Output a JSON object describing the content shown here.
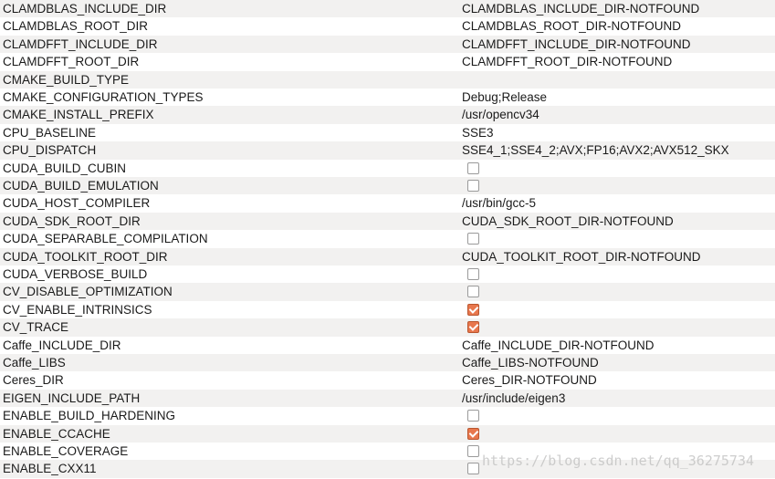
{
  "rows": [
    {
      "name": "CLAMDBLAS_INCLUDE_DIR",
      "type": "text",
      "value": "CLAMDBLAS_INCLUDE_DIR-NOTFOUND"
    },
    {
      "name": "CLAMDBLAS_ROOT_DIR",
      "type": "text",
      "value": "CLAMDBLAS_ROOT_DIR-NOTFOUND"
    },
    {
      "name": "CLAMDFFT_INCLUDE_DIR",
      "type": "text",
      "value": "CLAMDFFT_INCLUDE_DIR-NOTFOUND"
    },
    {
      "name": "CLAMDFFT_ROOT_DIR",
      "type": "text",
      "value": "CLAMDFFT_ROOT_DIR-NOTFOUND"
    },
    {
      "name": "CMAKE_BUILD_TYPE",
      "type": "text",
      "value": ""
    },
    {
      "name": "CMAKE_CONFIGURATION_TYPES",
      "type": "text",
      "value": "Debug;Release"
    },
    {
      "name": "CMAKE_INSTALL_PREFIX",
      "type": "text",
      "value": "/usr/opencv34"
    },
    {
      "name": "CPU_BASELINE",
      "type": "text",
      "value": "SSE3"
    },
    {
      "name": "CPU_DISPATCH",
      "type": "text",
      "value": "SSE4_1;SSE4_2;AVX;FP16;AVX2;AVX512_SKX"
    },
    {
      "name": "CUDA_BUILD_CUBIN",
      "type": "bool",
      "checked": false
    },
    {
      "name": "CUDA_BUILD_EMULATION",
      "type": "bool",
      "checked": false
    },
    {
      "name": "CUDA_HOST_COMPILER",
      "type": "text",
      "value": "/usr/bin/gcc-5"
    },
    {
      "name": "CUDA_SDK_ROOT_DIR",
      "type": "text",
      "value": "CUDA_SDK_ROOT_DIR-NOTFOUND"
    },
    {
      "name": "CUDA_SEPARABLE_COMPILATION",
      "type": "bool",
      "checked": false
    },
    {
      "name": "CUDA_TOOLKIT_ROOT_DIR",
      "type": "text",
      "value": "CUDA_TOOLKIT_ROOT_DIR-NOTFOUND"
    },
    {
      "name": "CUDA_VERBOSE_BUILD",
      "type": "bool",
      "checked": false
    },
    {
      "name": "CV_DISABLE_OPTIMIZATION",
      "type": "bool",
      "checked": false
    },
    {
      "name": "CV_ENABLE_INTRINSICS",
      "type": "bool",
      "checked": true
    },
    {
      "name": "CV_TRACE",
      "type": "bool",
      "checked": true
    },
    {
      "name": "Caffe_INCLUDE_DIR",
      "type": "text",
      "value": "Caffe_INCLUDE_DIR-NOTFOUND"
    },
    {
      "name": "Caffe_LIBS",
      "type": "text",
      "value": "Caffe_LIBS-NOTFOUND"
    },
    {
      "name": "Ceres_DIR",
      "type": "text",
      "value": "Ceres_DIR-NOTFOUND"
    },
    {
      "name": "EIGEN_INCLUDE_PATH",
      "type": "text",
      "value": "/usr/include/eigen3"
    },
    {
      "name": "ENABLE_BUILD_HARDENING",
      "type": "bool",
      "checked": false
    },
    {
      "name": "ENABLE_CCACHE",
      "type": "bool",
      "checked": true
    },
    {
      "name": "ENABLE_COVERAGE",
      "type": "bool",
      "checked": false
    },
    {
      "name": "ENABLE_CXX11",
      "type": "bool",
      "checked": false
    }
  ],
  "watermark": "https://blog.csdn.net/qq_36275734",
  "colors": {
    "row_alt": "#f2f1f0",
    "checkbox_checked": "#e8774d"
  }
}
